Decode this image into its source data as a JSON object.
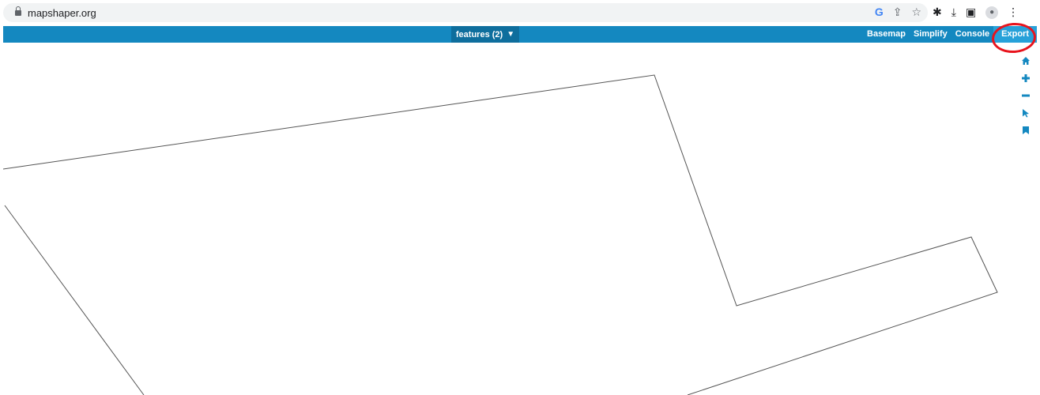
{
  "browser": {
    "url": "mapshaper.org",
    "icons": [
      "lock-icon",
      "google-icon",
      "share-icon",
      "star-icon",
      "extensions-icon",
      "download-icon",
      "side-panel-icon",
      "profile-icon",
      "menu-icon"
    ]
  },
  "toolbar": {
    "layer_menu_label": "features (2)",
    "nav_items": [
      "Basemap",
      "Simplify",
      "Console",
      "Export"
    ],
    "active_item": "Export",
    "colors": {
      "bar": "#1488c0",
      "layer_menu": "#0e6e9d",
      "active": "#27a1d9",
      "annotation": "#e8141d"
    }
  },
  "map_tools": [
    "home-icon",
    "zoom-in-icon",
    "zoom-out-icon",
    "select-pointer-icon",
    "bookmark-icon"
  ]
}
